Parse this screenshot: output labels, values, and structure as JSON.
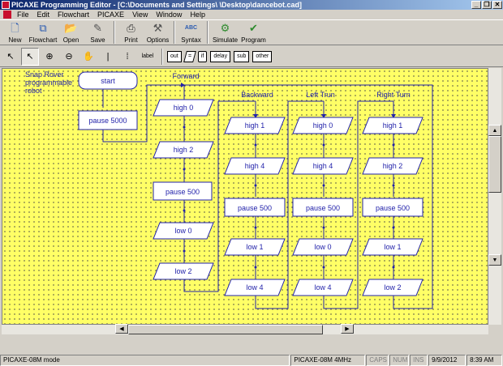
{
  "window": {
    "title": "PICAXE Programming Editor - [C:\\Documents and Settings\\                \\Desktop\\dancebot.cad]",
    "buttons": {
      "minimize": "_",
      "restore": "❐",
      "close": "✕"
    }
  },
  "menu": [
    "File",
    "Edit",
    "Flowchart",
    "PICAXE",
    "View",
    "Window",
    "Help"
  ],
  "toolbar": [
    {
      "label": "New",
      "icon": "new-file-icon",
      "glyph": "🗋"
    },
    {
      "label": "Flowchart",
      "icon": "flowchart-icon",
      "glyph": "⧉"
    },
    {
      "label": "Open",
      "icon": "open-folder-icon",
      "glyph": "📂"
    },
    {
      "label": "Save",
      "icon": "save-icon",
      "glyph": "✎"
    },
    {
      "label": "Print",
      "icon": "printer-icon",
      "glyph": "⎙"
    },
    {
      "label": "Options",
      "icon": "options-icon",
      "glyph": "⚒"
    },
    {
      "label": "Syntax",
      "icon": "syntax-check-icon",
      "glyph": "ABC"
    },
    {
      "label": "Simulate",
      "icon": "simulate-icon",
      "glyph": "⚙"
    },
    {
      "label": "Program",
      "icon": "program-icon",
      "glyph": "✔"
    }
  ],
  "tools": [
    {
      "name": "select-arrow-icon",
      "glyph": "↖",
      "pressed": false
    },
    {
      "name": "pointer-tool-icon",
      "glyph": "↖",
      "pressed": true
    },
    {
      "name": "zoom-in-icon",
      "glyph": "⊕",
      "pressed": false
    },
    {
      "name": "zoom-out-icon",
      "glyph": "⊖",
      "pressed": false
    },
    {
      "name": "pan-hand-icon",
      "glyph": "✋",
      "pressed": false
    },
    {
      "name": "line-tool-icon",
      "glyph": "|",
      "pressed": false
    },
    {
      "name": "connector-tool-icon",
      "glyph": "⁞",
      "pressed": false
    },
    {
      "name": "label-tool-icon",
      "glyph": "label",
      "pressed": false
    }
  ],
  "shapes": [
    "out",
    "=",
    "if",
    "delay",
    "sub",
    "other"
  ],
  "flowchart": {
    "note": [
      "Snap Rover",
      "programmable",
      "robot"
    ],
    "start": "start",
    "pause_main": "pause 5000",
    "labels": {
      "forward": "Forward",
      "backward": "Backward",
      "left": "Left Trun",
      "right": "Right Turn"
    },
    "forward": [
      "high 0",
      "high 2",
      "pause 500",
      "low 0",
      "low 2"
    ],
    "backward": [
      "high 1",
      "high 4",
      "pause 500",
      "low 1",
      "low 4"
    ],
    "left": [
      "high 0",
      "high 4",
      "pause 500",
      "low 0",
      "low 4"
    ],
    "right": [
      "high 1",
      "high 2",
      "pause 500",
      "low 1",
      "low 2"
    ]
  },
  "status": {
    "mode": "PICAXE-08M mode",
    "chip": "PICAXE-08M 4MHz",
    "caps": "CAPS",
    "num": "NUM",
    "ins": "INS",
    "date": "9/9/2012",
    "time": "8:39 AM"
  },
  "colors": {
    "canvas": "#ffff66",
    "shape_fill": "#ffffff",
    "shape_text": "#2222aa",
    "titlebar": "#0a246a"
  }
}
